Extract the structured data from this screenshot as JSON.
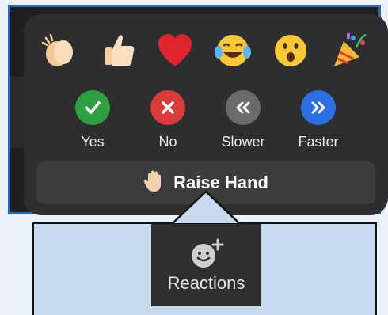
{
  "reactions_popup": {
    "emojis": [
      {
        "name": "clapping-hands",
        "glyph": "👏"
      },
      {
        "name": "thumbs-up",
        "glyph": "👍"
      },
      {
        "name": "red-heart",
        "glyph": "❤"
      },
      {
        "name": "tears-of-joy",
        "glyph": "😂"
      },
      {
        "name": "open-mouth",
        "glyph": "😮"
      },
      {
        "name": "party-popper",
        "glyph": "🎉"
      }
    ],
    "actions": [
      {
        "label": "Yes",
        "color": "#2ea043",
        "glyph": "✔"
      },
      {
        "label": "No",
        "color": "#d93a3a",
        "glyph": "✖"
      },
      {
        "label": "Slower",
        "color": "#6a6a6c",
        "glyph": "«"
      },
      {
        "label": "Faster",
        "color": "#2d6fe0",
        "glyph": "»"
      }
    ],
    "raise_hand_label": "Raise Hand"
  },
  "toolbar": {
    "reactions_label": "Reactions"
  },
  "colors": {
    "popup_bg": "#2e2e30",
    "window_border": "#2a6ab0",
    "callout_bg": "#c8dbee"
  }
}
